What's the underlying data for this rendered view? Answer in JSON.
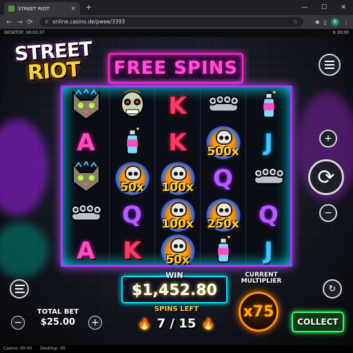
{
  "browser": {
    "tab_title": "STREET RIOT",
    "tab_close": "×",
    "new_tab": "+",
    "url": "online.casino.de/pwee/3393",
    "window_controls": [
      "—",
      "☐",
      "✕"
    ],
    "nav": [
      "←",
      "→",
      "⟳"
    ],
    "profile_initial": "B"
  },
  "status": {
    "left": "DESKTOP, 00:03:37",
    "right": "$ 30:00"
  },
  "game": {
    "logo_line1": "STREET",
    "logo_line2": "RIOT",
    "banner": "FREE SPINS",
    "reels": [
      [
        {
          "sym": "cat"
        },
        {
          "sym": "A"
        },
        {
          "sym": "cat"
        },
        {
          "sym": "knuckles"
        },
        {
          "sym": "A"
        }
      ],
      [
        {
          "sym": "zombie"
        },
        {
          "sym": "spray"
        },
        {
          "sym": "skull",
          "mult": "50x"
        },
        {
          "sym": "Q"
        },
        {
          "sym": "K"
        }
      ],
      [
        {
          "sym": "K"
        },
        {
          "sym": "K"
        },
        {
          "sym": "skull",
          "mult": "100x"
        },
        {
          "sym": "skull",
          "mult": "100x"
        },
        {
          "sym": "skull",
          "mult": "50x"
        }
      ],
      [
        {
          "sym": "knuckles"
        },
        {
          "sym": "skull",
          "mult": "500x"
        },
        {
          "sym": "Q"
        },
        {
          "sym": "skull",
          "mult": "250x"
        },
        {
          "sym": "spray"
        }
      ],
      [
        {
          "sym": "spray"
        },
        {
          "sym": "J"
        },
        {
          "sym": "knuckles"
        },
        {
          "sym": "Q"
        },
        {
          "sym": "J"
        }
      ]
    ],
    "win_label": "WIN",
    "win_value": "$1,452.80",
    "spins_label": "SPINS LEFT",
    "spins_value": "7 / 15",
    "multiplier_label": "CURRENT MULTIPLIER",
    "multiplier_value": "x75",
    "total_bet_label": "TOTAL BET",
    "total_bet_value": "$25.00",
    "collect_label": "COLLECT",
    "bet_minus": "−",
    "bet_plus": "+"
  },
  "footer": {
    "casino": "Casino: 00:00",
    "desktop": "Desktop: 00"
  },
  "colors": {
    "neon_pink": "#ff2bd6",
    "neon_cyan": "#00e0ff",
    "neon_green": "#39ff66",
    "multiplier_orange": "#ff9800",
    "gold": "#ffd23b"
  }
}
